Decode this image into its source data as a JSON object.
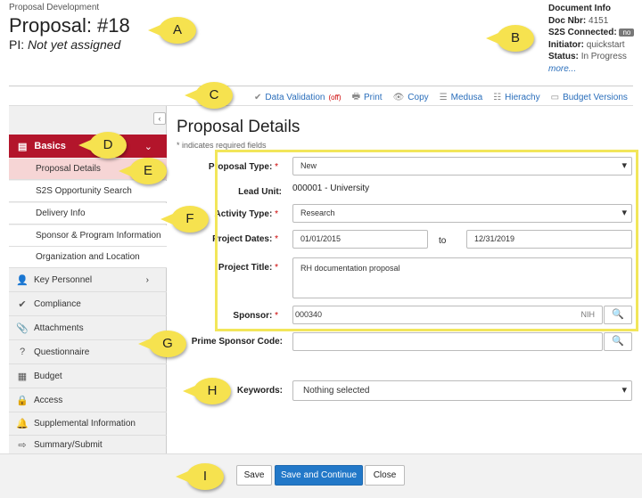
{
  "header": {
    "breadcrumb": "Proposal Development",
    "title": "Proposal: #18",
    "pi_label": "PI:",
    "pi_value": "Not yet assigned"
  },
  "document_info": {
    "heading": "Document Info",
    "doc_nbr_label": "Doc Nbr:",
    "doc_nbr": "4151",
    "s2s_label": "S2S Connected:",
    "s2s_value": "no",
    "initiator_label": "Initiator:",
    "initiator": "quickstart",
    "status_label": "Status:",
    "status": "In Progress",
    "more": "more..."
  },
  "toolbar": {
    "data_validation": "Data Validation",
    "off": "(off)",
    "print": "Print",
    "copy": "Copy",
    "medusa": "Medusa",
    "hierachy": "Hierachy",
    "budget_versions": "Budget Versions"
  },
  "sidebar": {
    "basics": "Basics",
    "sub_items": [
      "Proposal Details",
      "S2S Opportunity Search",
      "Delivery Info",
      "Sponsor & Program Information",
      "Organization and Location"
    ],
    "items": [
      {
        "label": "Key Personnel",
        "icon": "person-icon"
      },
      {
        "label": "Compliance",
        "icon": "check-icon"
      },
      {
        "label": "Attachments",
        "icon": "paperclip-icon"
      },
      {
        "label": "Questionnaire",
        "icon": "question-icon"
      },
      {
        "label": "Budget",
        "icon": "calculator-icon"
      },
      {
        "label": "Access",
        "icon": "lock-icon"
      },
      {
        "label": "Supplemental Information",
        "icon": "bell-icon"
      },
      {
        "label": "Summary/Submit",
        "icon": "submit-icon"
      }
    ]
  },
  "main": {
    "title": "Proposal Details",
    "required_note": "* indicates required fields",
    "proposal_type_label": "Proposal Type:",
    "proposal_type": "New",
    "lead_unit_label": "Lead Unit:",
    "lead_unit": "000001 - University",
    "activity_type_label": "Activity Type:",
    "activity_type": "Research",
    "project_dates_label": "Project Dates:",
    "start_date": "01/01/2015",
    "to": "to",
    "end_date": "12/31/2019",
    "project_title_label": "Project Title:",
    "project_title": "RH documentation proposal",
    "sponsor_label": "Sponsor:",
    "sponsor": "000340",
    "sponsor_suffix": "NIH",
    "prime_sponsor_label": "Prime Sponsor Code:",
    "prime_sponsor": "",
    "keywords_label": "Keywords:",
    "keywords": "Nothing selected",
    "required_star": "*"
  },
  "footer": {
    "save": "Save",
    "save_continue": "Save and Continue",
    "close": "Close"
  },
  "callouts": [
    "A",
    "B",
    "C",
    "D",
    "E",
    "F",
    "G",
    "H",
    "I"
  ],
  "colors": {
    "accent": "#b3152b",
    "primary_button": "#2278c8",
    "callout": "#f6e24f",
    "highlight_box": "#f2e65a"
  }
}
